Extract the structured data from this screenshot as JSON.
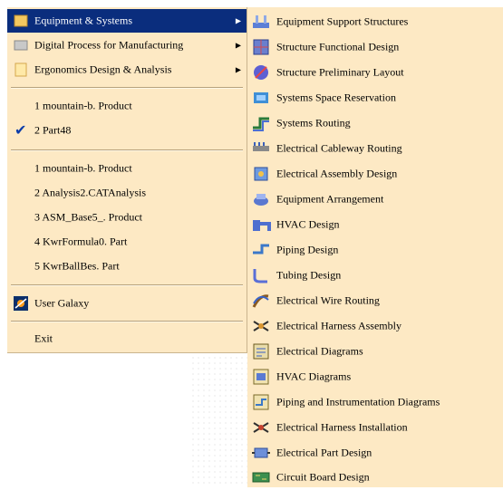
{
  "menu": {
    "items": [
      {
        "label": "Equipment & Systems",
        "icon": "equipment-systems-icon",
        "has_submenu": true,
        "highlighted": true
      },
      {
        "label": "Digital Process for Manufacturing",
        "icon": "digital-process-icon",
        "has_submenu": true
      },
      {
        "label": "Ergonomics Design & Analysis",
        "icon": "ergonomics-icon",
        "has_submenu": true
      }
    ],
    "recent_windows": [
      {
        "label": "1 mountain-b. Product"
      },
      {
        "label": "2 Part48",
        "checked": true
      }
    ],
    "recent_files": [
      {
        "label": "1 mountain-b. Product"
      },
      {
        "label": "2 Analysis2.CATAnalysis"
      },
      {
        "label": "3 ASM_Base5_. Product"
      },
      {
        "label": "4 KwrFormula0. Part"
      },
      {
        "label": "5 KwrBallBes. Part"
      }
    ],
    "user_galaxy": {
      "label": "User Galaxy",
      "icon": "user-galaxy-icon"
    },
    "exit": {
      "label": "Exit"
    }
  },
  "submenu": {
    "items": [
      {
        "label": "Equipment Support Structures",
        "icon": "equipment-support-icon"
      },
      {
        "label": "Structure Functional Design",
        "icon": "structure-functional-icon"
      },
      {
        "label": "Structure Preliminary Layout",
        "icon": "structure-preliminary-icon"
      },
      {
        "label": "Systems Space Reservation",
        "icon": "space-reservation-icon"
      },
      {
        "label": "Systems Routing",
        "icon": "systems-routing-icon"
      },
      {
        "label": "Electrical Cableway Routing",
        "icon": "cableway-routing-icon"
      },
      {
        "label": "Electrical Assembly Design",
        "icon": "electrical-assembly-icon"
      },
      {
        "label": "Equipment Arrangement",
        "icon": "equipment-arrangement-icon"
      },
      {
        "label": "HVAC Design",
        "icon": "hvac-design-icon"
      },
      {
        "label": "Piping Design",
        "icon": "piping-design-icon"
      },
      {
        "label": "Tubing Design",
        "icon": "tubing-design-icon"
      },
      {
        "label": "Electrical Wire Routing",
        "icon": "wire-routing-icon"
      },
      {
        "label": "Electrical Harness Assembly",
        "icon": "harness-assembly-icon"
      },
      {
        "label": "Electrical Diagrams",
        "icon": "electrical-diagrams-icon"
      },
      {
        "label": "HVAC Diagrams",
        "icon": "hvac-diagrams-icon"
      },
      {
        "label": "Piping and Instrumentation Diagrams",
        "icon": "piping-instrumentation-icon"
      },
      {
        "label": "Electrical Harness Installation",
        "icon": "harness-installation-icon"
      },
      {
        "label": "Electrical Part Design",
        "icon": "electrical-part-icon"
      },
      {
        "label": "Circuit Board Design",
        "icon": "circuit-board-icon"
      }
    ]
  },
  "colors": {
    "menu_bg": "#fde9c4",
    "highlight": "#0a2d7d"
  }
}
